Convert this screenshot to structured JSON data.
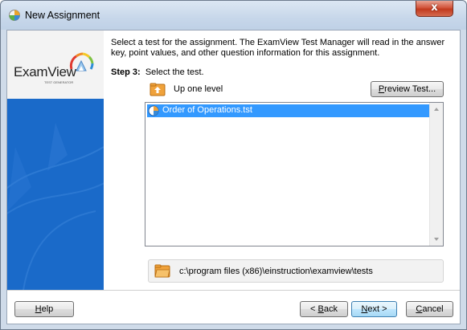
{
  "window": {
    "title": "New Assignment",
    "close_symbol": "x"
  },
  "logo": {
    "name": "ExamView",
    "tagline": "TEST GENERATOR"
  },
  "instructions": "Select a test for the assignment.  The ExamView Test Manager will read in the answer key, point values, and other question information for this assignment.",
  "step": {
    "label": "Step 3:",
    "text": "Select the test."
  },
  "up_level": {
    "label": "Up one level"
  },
  "preview_button": {
    "label_underlined": "P",
    "label_rest": "review Test..."
  },
  "file_list": {
    "items": [
      {
        "name": "Order of Operations.tst",
        "selected": true
      }
    ]
  },
  "current_path": "c:\\program files (x86)\\einstruction\\examview\\tests",
  "buttons": {
    "help": {
      "underlined": "H",
      "rest": "elp"
    },
    "back": {
      "prefix": "< ",
      "underlined": "B",
      "rest": "ack"
    },
    "next": {
      "underlined": "N",
      "rest": "ext >"
    },
    "cancel": {
      "underlined": "C",
      "rest": "ancel"
    }
  },
  "colors": {
    "accent_blue": "#1a6ac9",
    "selection": "#3399ff",
    "titlebar": "#c7d7ea"
  }
}
